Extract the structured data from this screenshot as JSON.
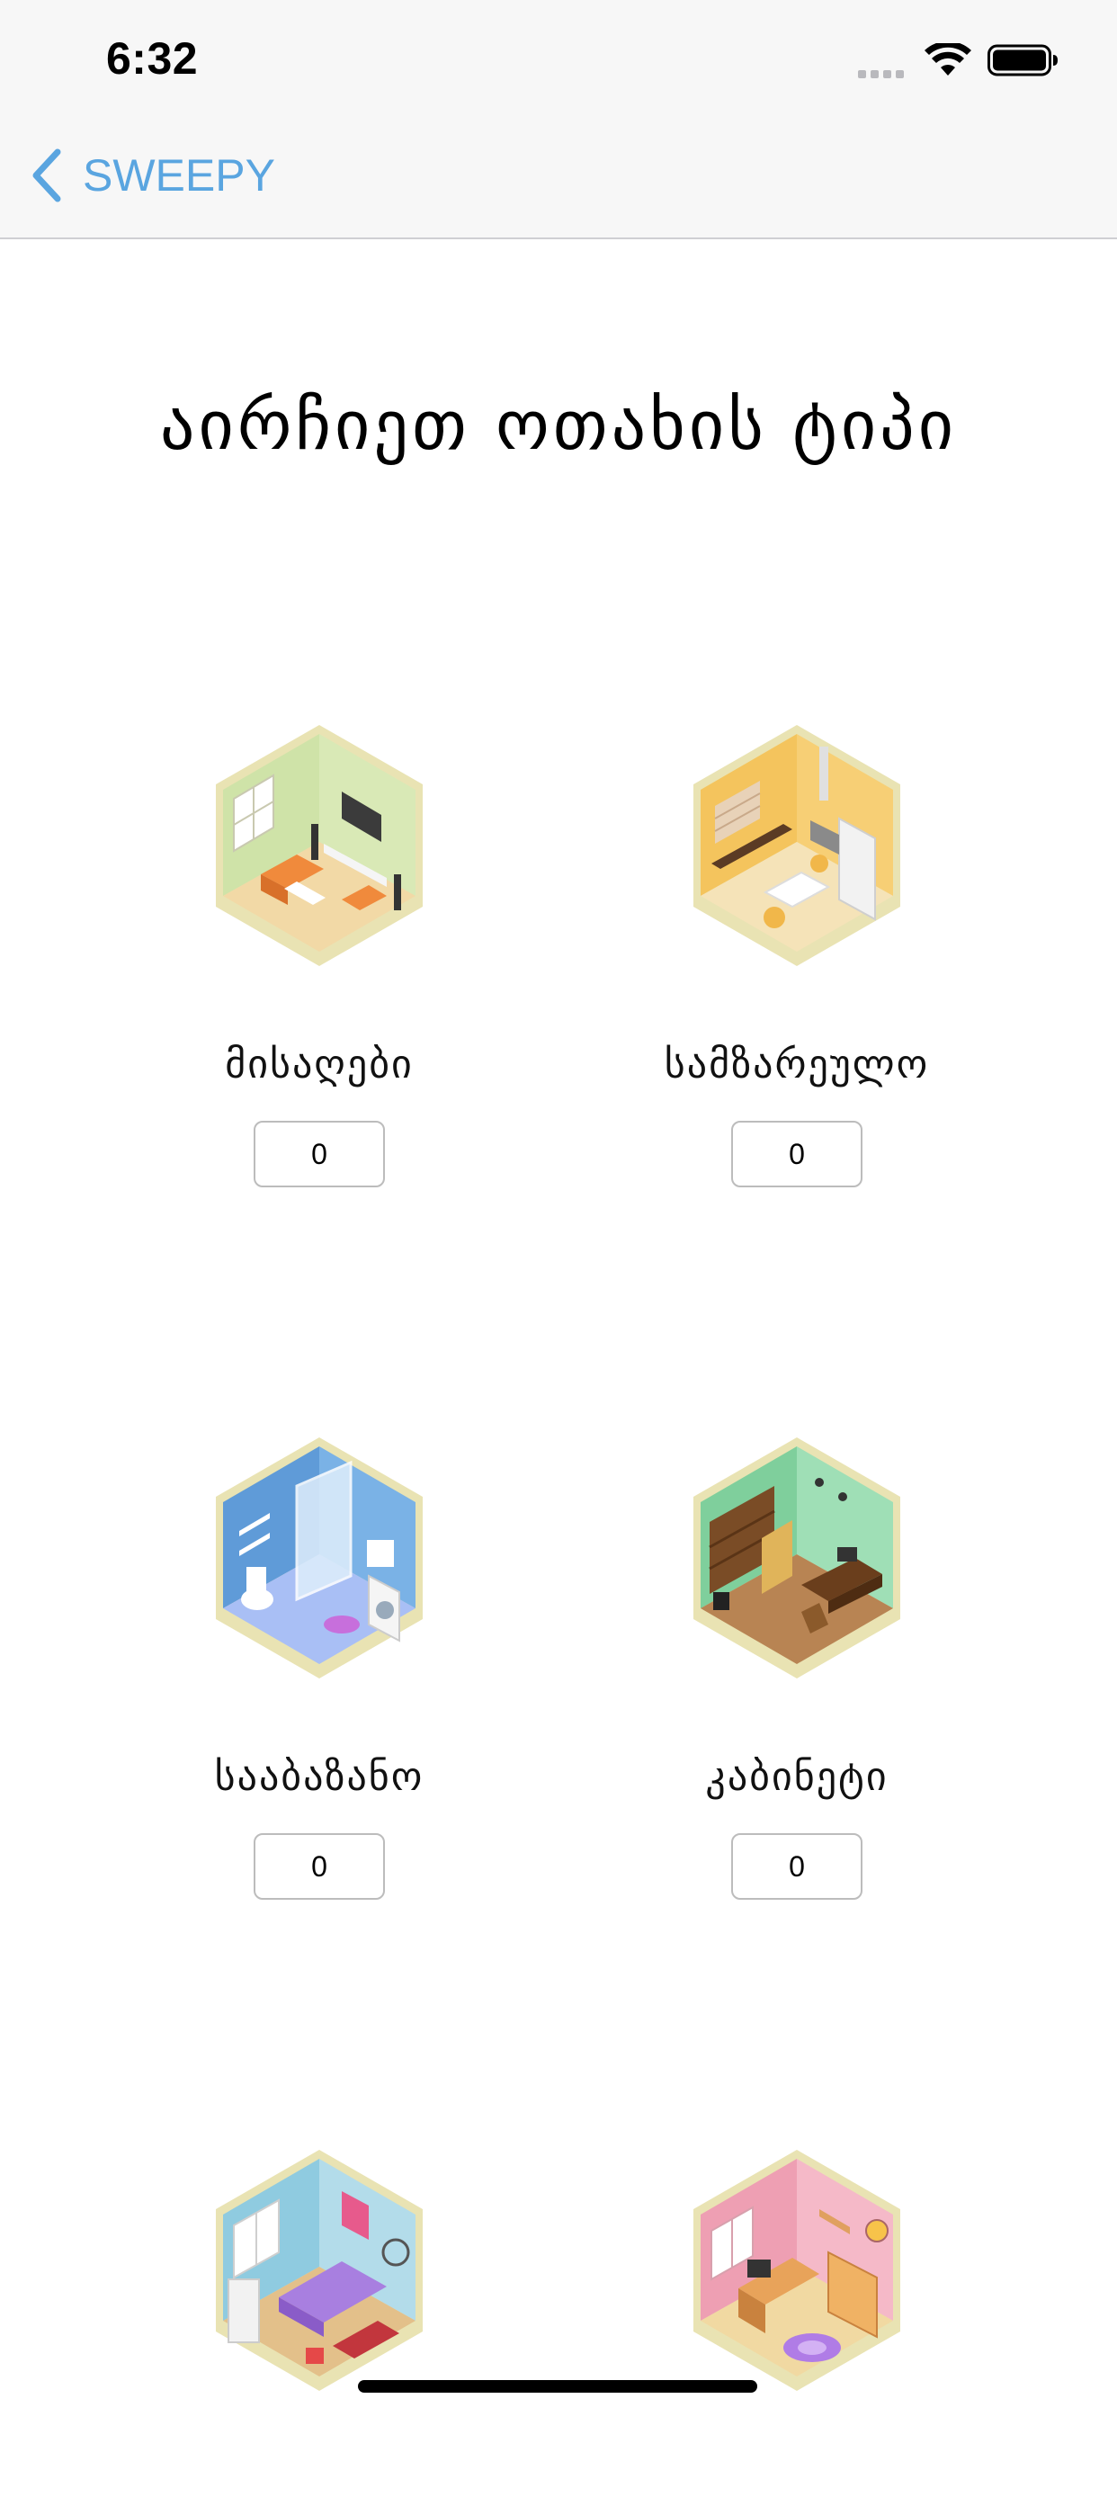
{
  "status_bar": {
    "time": "6:32"
  },
  "nav": {
    "back_label": "SWEEPY"
  },
  "page": {
    "title": "აირჩიეთ ოთახის ტიპი"
  },
  "rooms": [
    {
      "label": "მისაღები",
      "count": "0",
      "icon": "living-room-icon"
    },
    {
      "label": "სამზარეულო",
      "count": "0",
      "icon": "kitchen-icon"
    },
    {
      "label": "სააბაზანო",
      "count": "0",
      "icon": "bathroom-icon"
    },
    {
      "label": "კაბინეტი",
      "count": "0",
      "icon": "office-icon"
    },
    {
      "label": "",
      "count": "",
      "icon": "bedroom-icon"
    },
    {
      "label": "",
      "count": "",
      "icon": "kids-room-icon"
    }
  ],
  "colors": {
    "accent": "#5aa5e0",
    "nav_background": "#f7f7f7",
    "living_room_wall": "#cfe3a8",
    "kitchen_wall": "#f4c45d",
    "bathroom_wall": "#6aa6de",
    "office_wall": "#8fd4a8",
    "bedroom_wall": "#a6d6e6",
    "kids_room_wall": "#f0a9bb"
  }
}
